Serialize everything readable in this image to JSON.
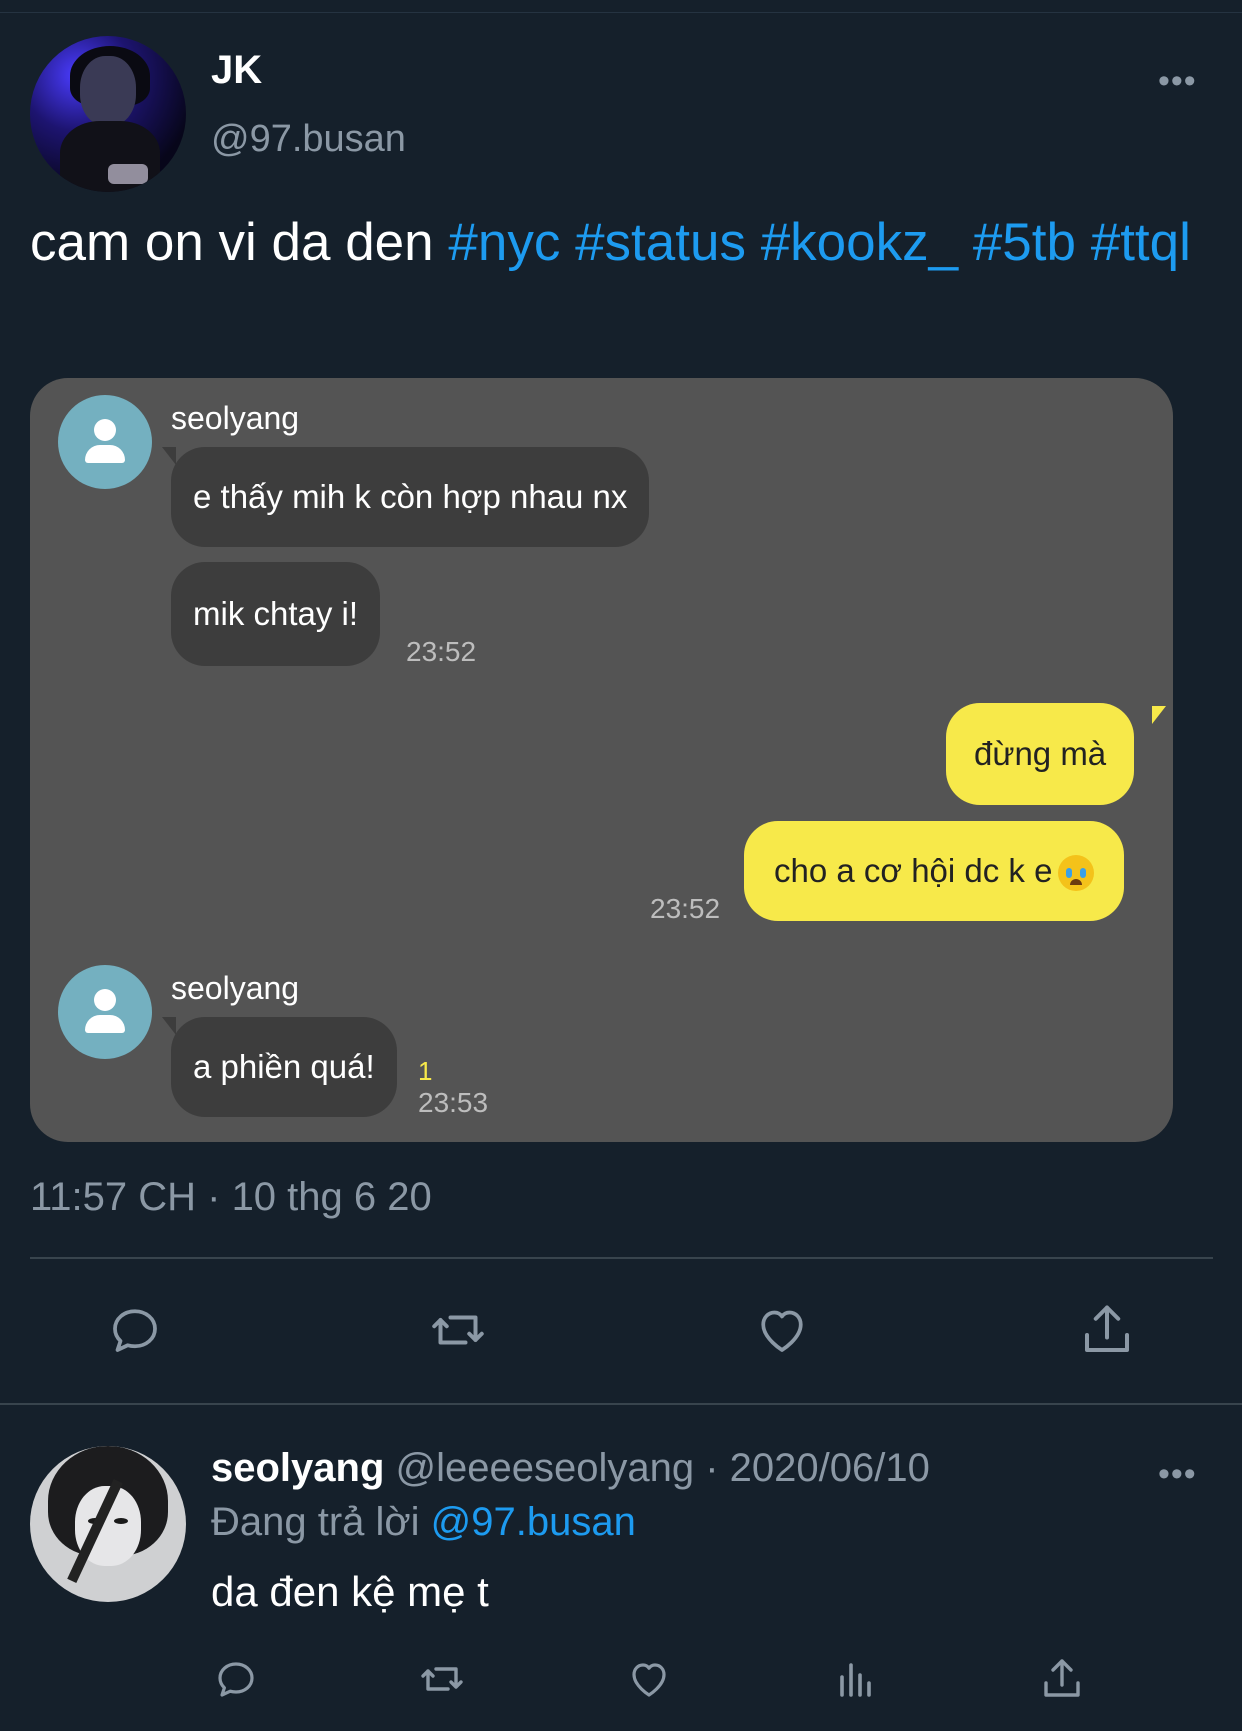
{
  "tweet": {
    "display_name": "JK",
    "handle": "@97.busan",
    "more": "•••",
    "text_plain": "cam on vi da den",
    "hashtags": [
      "#nyc",
      "#status",
      "#kookz_",
      "#5tb",
      "#ttql"
    ],
    "timestamp": "11:57 CH · 10 thg 6 20"
  },
  "chat": {
    "sender1": "seolyang",
    "msg1": "e thấy mih k còn hợp nhau nx",
    "msg2": "mik chtay i!",
    "time1": "23:52",
    "reply1": "đừng mà",
    "reply2": "cho a cơ hội dc k e",
    "reply2_emoji": "crying-face",
    "time2": "23:52",
    "sender2": "seolyang",
    "msg3": "a phiền quá!",
    "unread": "1",
    "time3": "23:53"
  },
  "actions": [
    "reply-icon",
    "retweet-icon",
    "like-icon",
    "share-icon"
  ],
  "reply": {
    "name": "seolyang",
    "handle": "@leeeeseolyang",
    "separator": " · ",
    "date": "2020/06/10",
    "replying_to_label": "Đang trả lời",
    "replying_to_handle": "@97.busan",
    "text": "da đen kệ mẹ t",
    "more": "•••"
  },
  "colors": {
    "background": "#15202b",
    "accent": "#1d9bf0",
    "muted": "#8b98a5",
    "bubble_yellow": "#f7e94a",
    "bubble_dark": "#3d3d3d",
    "card": "#545454"
  }
}
